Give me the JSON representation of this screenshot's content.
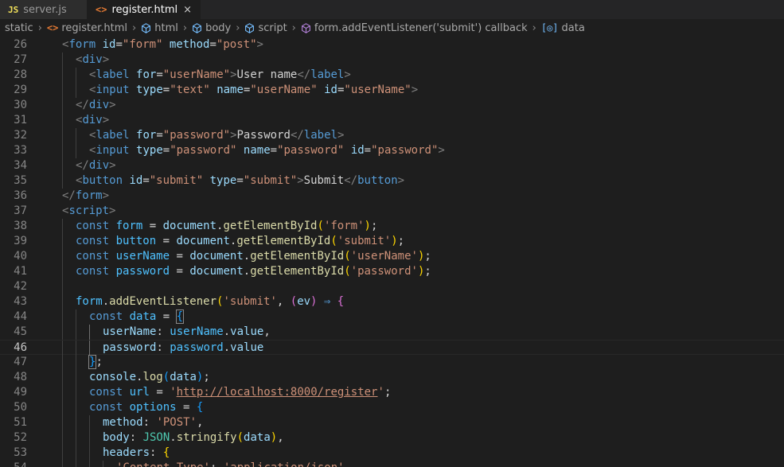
{
  "tabs": [
    {
      "label": "server.js",
      "icon": "JS",
      "active": false
    },
    {
      "label": "register.html",
      "icon": "<>",
      "active": true,
      "close": "×"
    }
  ],
  "breadcrumbs": [
    "static",
    "register.html",
    "html",
    "body",
    "script",
    "form.addEventListener('submit') callback",
    "data"
  ],
  "current_line": 46,
  "lines": [
    {
      "n": 26,
      "indent": 1,
      "tokens": [
        [
          "t-punct",
          "<"
        ],
        [
          "t-tag",
          "form"
        ],
        [
          "t-txt",
          " "
        ],
        [
          "t-attr",
          "id"
        ],
        [
          "t-txt",
          "="
        ],
        [
          "t-str",
          "\"form\""
        ],
        [
          "t-txt",
          " "
        ],
        [
          "t-attr",
          "method"
        ],
        [
          "t-txt",
          "="
        ],
        [
          "t-str",
          "\"post\""
        ],
        [
          "t-punct",
          ">"
        ]
      ]
    },
    {
      "n": 27,
      "indent": 2,
      "tokens": [
        [
          "t-punct",
          "<"
        ],
        [
          "t-tag",
          "div"
        ],
        [
          "t-punct",
          ">"
        ]
      ]
    },
    {
      "n": 28,
      "indent": 3,
      "tokens": [
        [
          "t-punct",
          "<"
        ],
        [
          "t-tag",
          "label"
        ],
        [
          "t-txt",
          " "
        ],
        [
          "t-attr",
          "for"
        ],
        [
          "t-txt",
          "="
        ],
        [
          "t-str",
          "\"userName\""
        ],
        [
          "t-punct",
          ">"
        ],
        [
          "t-txt",
          "User name"
        ],
        [
          "t-punct",
          "</"
        ],
        [
          "t-tag",
          "label"
        ],
        [
          "t-punct",
          ">"
        ]
      ]
    },
    {
      "n": 29,
      "indent": 3,
      "tokens": [
        [
          "t-punct",
          "<"
        ],
        [
          "t-tag",
          "input"
        ],
        [
          "t-txt",
          " "
        ],
        [
          "t-attr",
          "type"
        ],
        [
          "t-txt",
          "="
        ],
        [
          "t-str",
          "\"text\""
        ],
        [
          "t-txt",
          " "
        ],
        [
          "t-attr",
          "name"
        ],
        [
          "t-txt",
          "="
        ],
        [
          "t-str",
          "\"userName\""
        ],
        [
          "t-txt",
          " "
        ],
        [
          "t-attr",
          "id"
        ],
        [
          "t-txt",
          "="
        ],
        [
          "t-str",
          "\"userName\""
        ],
        [
          "t-punct",
          ">"
        ]
      ]
    },
    {
      "n": 30,
      "indent": 2,
      "tokens": [
        [
          "t-punct",
          "</"
        ],
        [
          "t-tag",
          "div"
        ],
        [
          "t-punct",
          ">"
        ]
      ]
    },
    {
      "n": 31,
      "indent": 2,
      "tokens": [
        [
          "t-punct",
          "<"
        ],
        [
          "t-tag",
          "div"
        ],
        [
          "t-punct",
          ">"
        ]
      ]
    },
    {
      "n": 32,
      "indent": 3,
      "tokens": [
        [
          "t-punct",
          "<"
        ],
        [
          "t-tag",
          "label"
        ],
        [
          "t-txt",
          " "
        ],
        [
          "t-attr",
          "for"
        ],
        [
          "t-txt",
          "="
        ],
        [
          "t-str",
          "\"password\""
        ],
        [
          "t-punct",
          ">"
        ],
        [
          "t-txt",
          "Password"
        ],
        [
          "t-punct",
          "</"
        ],
        [
          "t-tag",
          "label"
        ],
        [
          "t-punct",
          ">"
        ]
      ]
    },
    {
      "n": 33,
      "indent": 3,
      "tokens": [
        [
          "t-punct",
          "<"
        ],
        [
          "t-tag",
          "input"
        ],
        [
          "t-txt",
          " "
        ],
        [
          "t-attr",
          "type"
        ],
        [
          "t-txt",
          "="
        ],
        [
          "t-str",
          "\"password\""
        ],
        [
          "t-txt",
          " "
        ],
        [
          "t-attr",
          "name"
        ],
        [
          "t-txt",
          "="
        ],
        [
          "t-str",
          "\"password\""
        ],
        [
          "t-txt",
          " "
        ],
        [
          "t-attr",
          "id"
        ],
        [
          "t-txt",
          "="
        ],
        [
          "t-str",
          "\"password\""
        ],
        [
          "t-punct",
          ">"
        ]
      ]
    },
    {
      "n": 34,
      "indent": 2,
      "tokens": [
        [
          "t-punct",
          "</"
        ],
        [
          "t-tag",
          "div"
        ],
        [
          "t-punct",
          ">"
        ]
      ]
    },
    {
      "n": 35,
      "indent": 2,
      "tokens": [
        [
          "t-punct",
          "<"
        ],
        [
          "t-tag",
          "button"
        ],
        [
          "t-txt",
          " "
        ],
        [
          "t-attr",
          "id"
        ],
        [
          "t-txt",
          "="
        ],
        [
          "t-str",
          "\"submit\""
        ],
        [
          "t-txt",
          " "
        ],
        [
          "t-attr",
          "type"
        ],
        [
          "t-txt",
          "="
        ],
        [
          "t-str",
          "\"submit\""
        ],
        [
          "t-punct",
          ">"
        ],
        [
          "t-txt",
          "Submit"
        ],
        [
          "t-punct",
          "</"
        ],
        [
          "t-tag",
          "button"
        ],
        [
          "t-punct",
          ">"
        ]
      ]
    },
    {
      "n": 36,
      "indent": 1,
      "tokens": [
        [
          "t-punct",
          "</"
        ],
        [
          "t-tag",
          "form"
        ],
        [
          "t-punct",
          ">"
        ]
      ]
    },
    {
      "n": 37,
      "indent": 1,
      "tokens": [
        [
          "t-punct",
          "<"
        ],
        [
          "t-tag",
          "script"
        ],
        [
          "t-punct",
          ">"
        ]
      ]
    },
    {
      "n": 38,
      "indent": 2,
      "tokens": [
        [
          "t-kw",
          "const"
        ],
        [
          "t-txt",
          " "
        ],
        [
          "t-var",
          "form"
        ],
        [
          "t-txt",
          " = "
        ],
        [
          "t-prop",
          "document"
        ],
        [
          "t-txt",
          "."
        ],
        [
          "t-fn",
          "getElementById"
        ],
        [
          "t-b1",
          "("
        ],
        [
          "t-str",
          "'form'"
        ],
        [
          "t-b1",
          ")"
        ],
        [
          "t-txt",
          ";"
        ]
      ]
    },
    {
      "n": 39,
      "indent": 2,
      "tokens": [
        [
          "t-kw",
          "const"
        ],
        [
          "t-txt",
          " "
        ],
        [
          "t-var",
          "button"
        ],
        [
          "t-txt",
          " = "
        ],
        [
          "t-prop",
          "document"
        ],
        [
          "t-txt",
          "."
        ],
        [
          "t-fn",
          "getElementById"
        ],
        [
          "t-b1",
          "("
        ],
        [
          "t-str",
          "'submit'"
        ],
        [
          "t-b1",
          ")"
        ],
        [
          "t-txt",
          ";"
        ]
      ]
    },
    {
      "n": 40,
      "indent": 2,
      "tokens": [
        [
          "t-kw",
          "const"
        ],
        [
          "t-txt",
          " "
        ],
        [
          "t-var",
          "userName"
        ],
        [
          "t-txt",
          " = "
        ],
        [
          "t-prop",
          "document"
        ],
        [
          "t-txt",
          "."
        ],
        [
          "t-fn",
          "getElementById"
        ],
        [
          "t-b1",
          "("
        ],
        [
          "t-str",
          "'userName'"
        ],
        [
          "t-b1",
          ")"
        ],
        [
          "t-txt",
          ";"
        ]
      ]
    },
    {
      "n": 41,
      "indent": 2,
      "tokens": [
        [
          "t-kw",
          "const"
        ],
        [
          "t-txt",
          " "
        ],
        [
          "t-var",
          "password"
        ],
        [
          "t-txt",
          " = "
        ],
        [
          "t-prop",
          "document"
        ],
        [
          "t-txt",
          "."
        ],
        [
          "t-fn",
          "getElementById"
        ],
        [
          "t-b1",
          "("
        ],
        [
          "t-str",
          "'password'"
        ],
        [
          "t-b1",
          ")"
        ],
        [
          "t-txt",
          ";"
        ]
      ]
    },
    {
      "n": 42,
      "indent": 2,
      "tokens": []
    },
    {
      "n": 43,
      "indent": 2,
      "tokens": [
        [
          "t-var",
          "form"
        ],
        [
          "t-txt",
          "."
        ],
        [
          "t-fn",
          "addEventListener"
        ],
        [
          "t-b1",
          "("
        ],
        [
          "t-str",
          "'submit'"
        ],
        [
          "t-txt",
          ", "
        ],
        [
          "t-b2",
          "("
        ],
        [
          "t-prop",
          "ev"
        ],
        [
          "t-b2",
          ")"
        ],
        [
          "t-txt",
          " "
        ],
        [
          "t-kw",
          "⇒"
        ],
        [
          "t-txt",
          " "
        ],
        [
          "t-b2",
          "{"
        ]
      ]
    },
    {
      "n": 44,
      "indent": 3,
      "tokens": [
        [
          "t-kw",
          "const"
        ],
        [
          "t-txt",
          " "
        ],
        [
          "t-var",
          "data"
        ],
        [
          "t-txt",
          " = "
        ],
        [
          "t-b3 bm",
          "{"
        ]
      ]
    },
    {
      "n": 45,
      "indent": 4,
      "tokens": [
        [
          "t-prop",
          "userName"
        ],
        [
          "t-txt",
          ": "
        ],
        [
          "t-var",
          "userName"
        ],
        [
          "t-txt",
          "."
        ],
        [
          "t-prop",
          "value"
        ],
        [
          "t-txt",
          ","
        ]
      ]
    },
    {
      "n": 46,
      "indent": 4,
      "tokens": [
        [
          "t-prop",
          "password"
        ],
        [
          "t-txt",
          ": "
        ],
        [
          "t-var",
          "password"
        ],
        [
          "t-txt",
          "."
        ],
        [
          "t-prop",
          "value"
        ]
      ]
    },
    {
      "n": 47,
      "indent": 3,
      "tokens": [
        [
          "t-b3 bm",
          "}"
        ],
        [
          "t-txt",
          ";"
        ]
      ]
    },
    {
      "n": 48,
      "indent": 3,
      "tokens": [
        [
          "t-prop",
          "console"
        ],
        [
          "t-txt",
          "."
        ],
        [
          "t-fn",
          "log"
        ],
        [
          "t-b3",
          "("
        ],
        [
          "t-prop",
          "data"
        ],
        [
          "t-b3",
          ")"
        ],
        [
          "t-txt",
          ";"
        ]
      ]
    },
    {
      "n": 49,
      "indent": 3,
      "tokens": [
        [
          "t-kw",
          "const"
        ],
        [
          "t-txt",
          " "
        ],
        [
          "t-var",
          "url"
        ],
        [
          "t-txt",
          " = "
        ],
        [
          "t-str",
          "'"
        ],
        [
          "t-url",
          "http://localhost:8000/register"
        ],
        [
          "t-str",
          "'"
        ],
        [
          "t-txt",
          ";"
        ]
      ]
    },
    {
      "n": 50,
      "indent": 3,
      "tokens": [
        [
          "t-kw",
          "const"
        ],
        [
          "t-txt",
          " "
        ],
        [
          "t-var",
          "options"
        ],
        [
          "t-txt",
          " = "
        ],
        [
          "t-b3",
          "{"
        ]
      ]
    },
    {
      "n": 51,
      "indent": 4,
      "tokens": [
        [
          "t-prop",
          "method"
        ],
        [
          "t-txt",
          ": "
        ],
        [
          "t-str",
          "'POST'"
        ],
        [
          "t-txt",
          ","
        ]
      ]
    },
    {
      "n": 52,
      "indent": 4,
      "tokens": [
        [
          "t-prop",
          "body"
        ],
        [
          "t-txt",
          ": "
        ],
        [
          "t-cls",
          "JSON"
        ],
        [
          "t-txt",
          "."
        ],
        [
          "t-fn",
          "stringify"
        ],
        [
          "t-b1",
          "("
        ],
        [
          "t-prop",
          "data"
        ],
        [
          "t-b1",
          ")"
        ],
        [
          "t-txt",
          ","
        ]
      ]
    },
    {
      "n": 53,
      "indent": 4,
      "tokens": [
        [
          "t-prop",
          "headers"
        ],
        [
          "t-txt",
          ": "
        ],
        [
          "t-b1",
          "{"
        ]
      ]
    },
    {
      "n": 54,
      "indent": 5,
      "tokens": [
        [
          "t-str",
          "'Content-Type'"
        ],
        [
          "t-txt",
          ": "
        ],
        [
          "t-str",
          "'application/json'"
        ]
      ]
    }
  ]
}
